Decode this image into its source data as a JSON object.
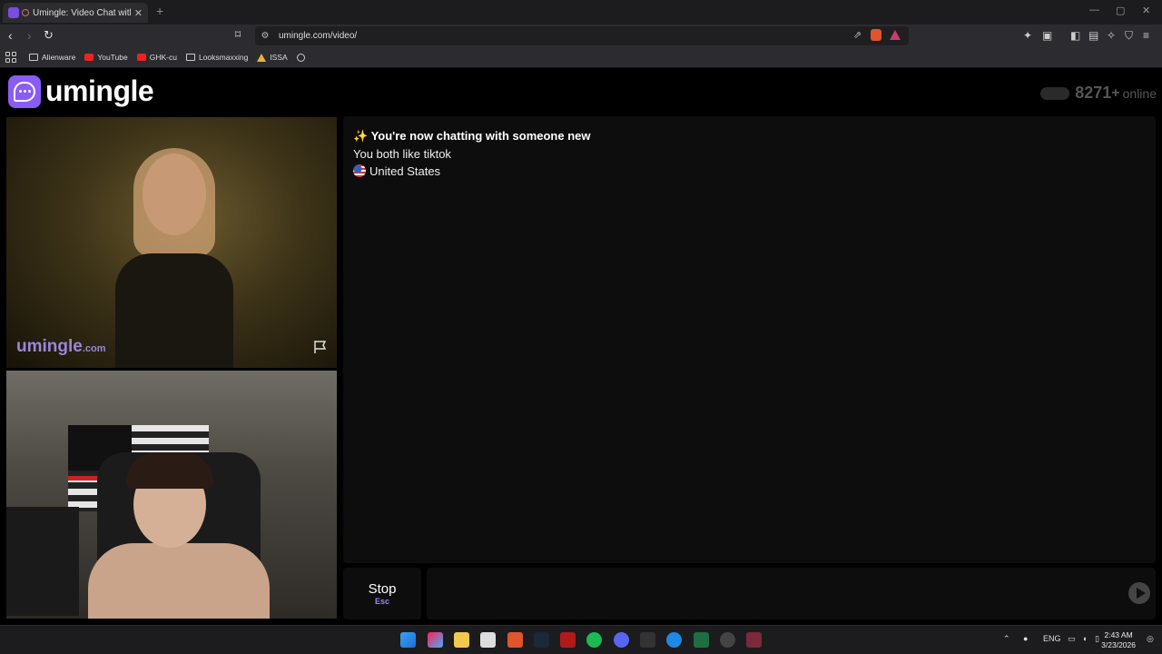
{
  "browser": {
    "tab_title": "Umingle: Video Chat with Str",
    "new_tab": "+",
    "close_tab": "✕",
    "url": "umingle.com/video/",
    "win_minimize": "—",
    "win_maximize": "▢",
    "win_close": "✕"
  },
  "bookmarks": [
    {
      "label": "Alienware",
      "icon": "folder-icon"
    },
    {
      "label": "YouTube",
      "icon": "youtube-icon"
    },
    {
      "label": "GHK-cu",
      "icon": "youtube-icon"
    },
    {
      "label": "Looksmaxxing",
      "icon": "folder-icon"
    },
    {
      "label": "ISSA",
      "icon": "triangle-icon"
    },
    {
      "label": "",
      "icon": "globe-icon"
    }
  ],
  "header": {
    "logo_text": "umingle",
    "online_count": "8271",
    "online_plus": "+",
    "online_label": "online"
  },
  "video": {
    "watermark_main": "umingle",
    "watermark_suffix": ".com"
  },
  "chat": {
    "message_1": "✨ You're now chatting with someone new",
    "message_2": "You both like tiktok",
    "message_3": "United States"
  },
  "controls": {
    "stop_label": "Stop",
    "stop_key": "Esc",
    "message_placeholder": ""
  },
  "taskbar": {
    "lang": "ENG",
    "time": "2:43 AM",
    "date": "3/23/2026"
  },
  "colors": {
    "brand": "#8a5cf6",
    "page_bg": "#000000",
    "panel_bg": "#0d0d0d"
  }
}
